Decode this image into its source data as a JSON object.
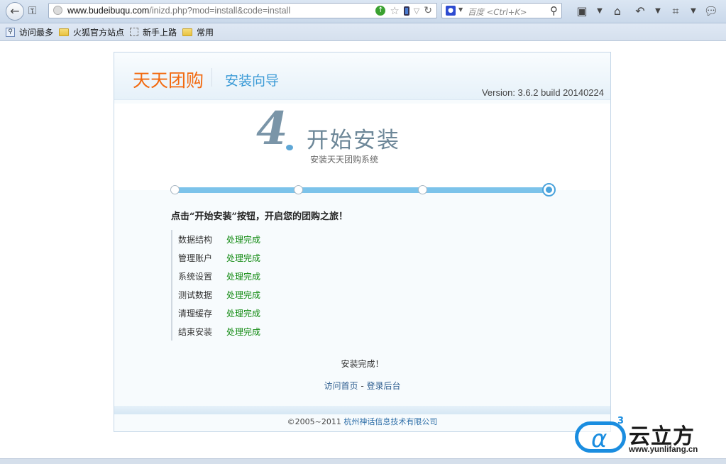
{
  "browser": {
    "url_host": "www.budeibuqu.com",
    "url_path": "/inizd.php?mod=install&code=install",
    "search_placeholder": "百度 <Ctrl+K>"
  },
  "bookmarks": [
    {
      "label": "访问最多",
      "icon": "search-icon"
    },
    {
      "label": "火狐官方站点",
      "icon": "folder-icon"
    },
    {
      "label": "新手上路",
      "icon": "dashed-box-icon"
    },
    {
      "label": "常用",
      "icon": "folder-icon"
    }
  ],
  "header": {
    "logo": "天天团购",
    "subtitle": "安装向导",
    "version": "Version: 3.6.2 build 20140224"
  },
  "step": {
    "number": "4",
    "dot": ".",
    "title": "开始安装",
    "description": "安装天天团购系统",
    "current": 4,
    "total": 4
  },
  "instruction": "点击“开始安装”按钮，开启您的团购之旅！",
  "tasks": [
    {
      "label": "数据结构",
      "status": "处理完成"
    },
    {
      "label": "管理账户",
      "status": "处理完成"
    },
    {
      "label": "系统设置",
      "status": "处理完成"
    },
    {
      "label": "测试数据",
      "status": "处理完成"
    },
    {
      "label": "清理缓存",
      "status": "处理完成"
    },
    {
      "label": "结束安装",
      "status": "处理完成"
    }
  ],
  "done_message": "安装完成！",
  "links": {
    "home": "访问首页",
    "separator": " - ",
    "admin": "登录后台"
  },
  "footer": {
    "copyright": "©2005~2011 ",
    "company": "杭州神话信息技术有限公司"
  },
  "watermark": {
    "badge": "3",
    "text": "云立方",
    "url": "www.yunlifang.cn"
  },
  "colors": {
    "logo": "#f26a10",
    "accent": "#3a9ad6",
    "progress": "#7cc3ea",
    "success": "#118a11"
  }
}
